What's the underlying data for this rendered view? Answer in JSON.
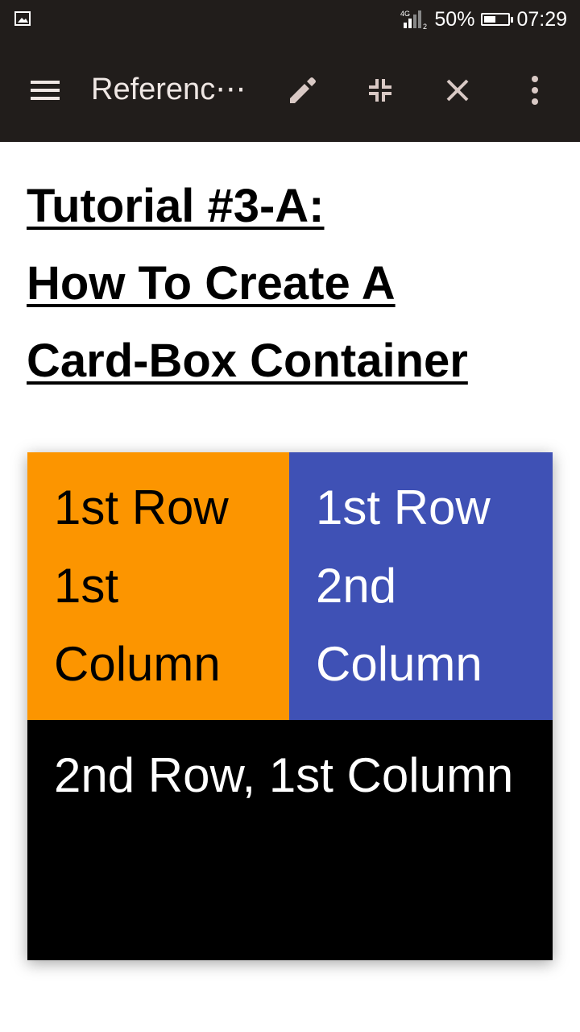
{
  "status_bar": {
    "network": "4G",
    "sim_slot": "2",
    "battery": "50%",
    "battery_level": 0.5,
    "time": "07:29"
  },
  "app_bar": {
    "title": "Referenc⋯",
    "icons": [
      "menu-icon",
      "edit-icon",
      "shrink-icon",
      "close-icon",
      "more-vert-icon"
    ]
  },
  "article": {
    "title_line1": "Tutorial #3-A:",
    "title_line2": "How To Create A",
    "title_line3": "Card-Box Container"
  },
  "card": {
    "row1_col1": "1st Row 1st Column",
    "row1_col2": "1st Row 2nd Column",
    "row2_col1": "2nd Row, 1st Column"
  },
  "colors": {
    "bar_bg": "#211d1b",
    "orange": "#fc9500",
    "indigo": "#3f51b5",
    "black": "#000000"
  }
}
